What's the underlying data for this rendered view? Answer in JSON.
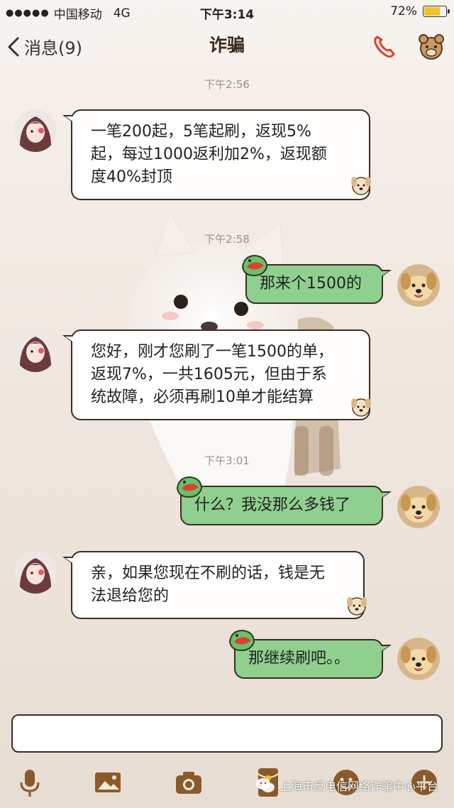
{
  "status_bar": {
    "signal": "●●●●●",
    "carrier": "中国移动",
    "network": "4G",
    "time": "下午3:14",
    "battery_text": "72%",
    "battery_level": 0.72
  },
  "nav": {
    "back_label": "消息(9)",
    "title": "诈骗"
  },
  "messages": [
    {
      "timestamp": "下午2:56",
      "side": "in",
      "lines": [
        "一笔200起，5笔起刷，返现5%",
        "起，每过1000返利加2%，返现额",
        "度40%封顶"
      ]
    },
    {
      "timestamp": "下午2:58",
      "side": "out",
      "lines": [
        "那来个1500的"
      ]
    },
    {
      "side": "in",
      "lines": [
        "您好，刚才您刷了一笔1500的单，",
        "返现7%，一共1605元，但由于系",
        "统故障，必须再刷10单才能结算"
      ]
    },
    {
      "timestamp": "下午3:01",
      "side": "out",
      "lines": [
        "什么？我没那么多钱了"
      ]
    },
    {
      "side": "in",
      "lines": [
        "亲，如果您现在不刷的话，钱是无",
        "法退给您的"
      ]
    },
    {
      "side": "out",
      "lines": [
        "那继续刷吧。。"
      ]
    }
  ],
  "input": {
    "value": "",
    "placeholder": ""
  },
  "toolbar": {
    "icons": [
      "microphone-icon",
      "image-icon",
      "camera-icon",
      "red-packet-icon",
      "emoji-icon",
      "plus-icon"
    ]
  },
  "watermark": {
    "text": "上海市反电信网络诈骗中心平台"
  },
  "colors": {
    "outgoing_bubble": "#8fd08f",
    "incoming_bubble": "#fffefc",
    "bubble_border": "#3b2d24",
    "accent_brown": "#8b5a2b",
    "call_icon": "#d9442e",
    "battery_fill": "#f2c12e"
  }
}
